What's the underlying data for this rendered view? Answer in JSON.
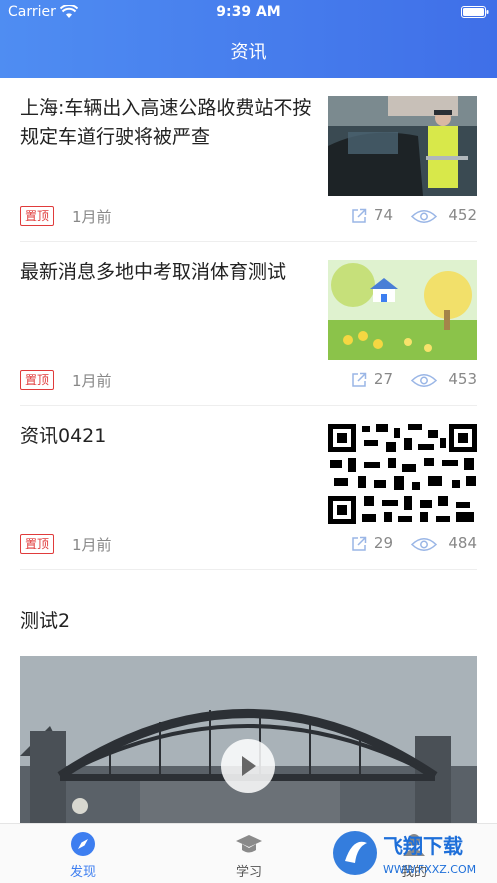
{
  "status_bar": {
    "carrier": "Carrier",
    "time": "9:39 AM"
  },
  "nav": {
    "title": "资讯"
  },
  "articles": [
    {
      "title": "上海:车辆出入高速公路收费站不按规定车道行驶将被严查",
      "badge": "置顶",
      "time_ago": "1月前",
      "shares": "74",
      "views": "452",
      "thumb_icon": "highway-toll-photo"
    },
    {
      "title": "最新消息多地中考取消体育测试",
      "badge": "置顶",
      "time_ago": "1月前",
      "shares": "27",
      "views": "453",
      "thumb_icon": "cartoon-landscape-photo"
    },
    {
      "title": "资讯0421",
      "badge": "置顶",
      "time_ago": "1月前",
      "shares": "29",
      "views": "484",
      "thumb_icon": "qr-code-image"
    }
  ],
  "video": {
    "title": "测试2",
    "thumb_icon": "harbour-bridge-photo"
  },
  "tabs": [
    {
      "label": "发现",
      "icon": "compass-icon",
      "active": true
    },
    {
      "label": "学习",
      "icon": "graduation-cap-icon",
      "active": false
    },
    {
      "label": "我的",
      "icon": "user-icon",
      "active": false
    }
  ],
  "watermark": {
    "text": "飞翔下载",
    "url": "WWW.FXXZ.COM"
  },
  "colors": {
    "header": "#4a84ee",
    "accent": "#3d7ef0",
    "badge": "#e03b3b"
  }
}
